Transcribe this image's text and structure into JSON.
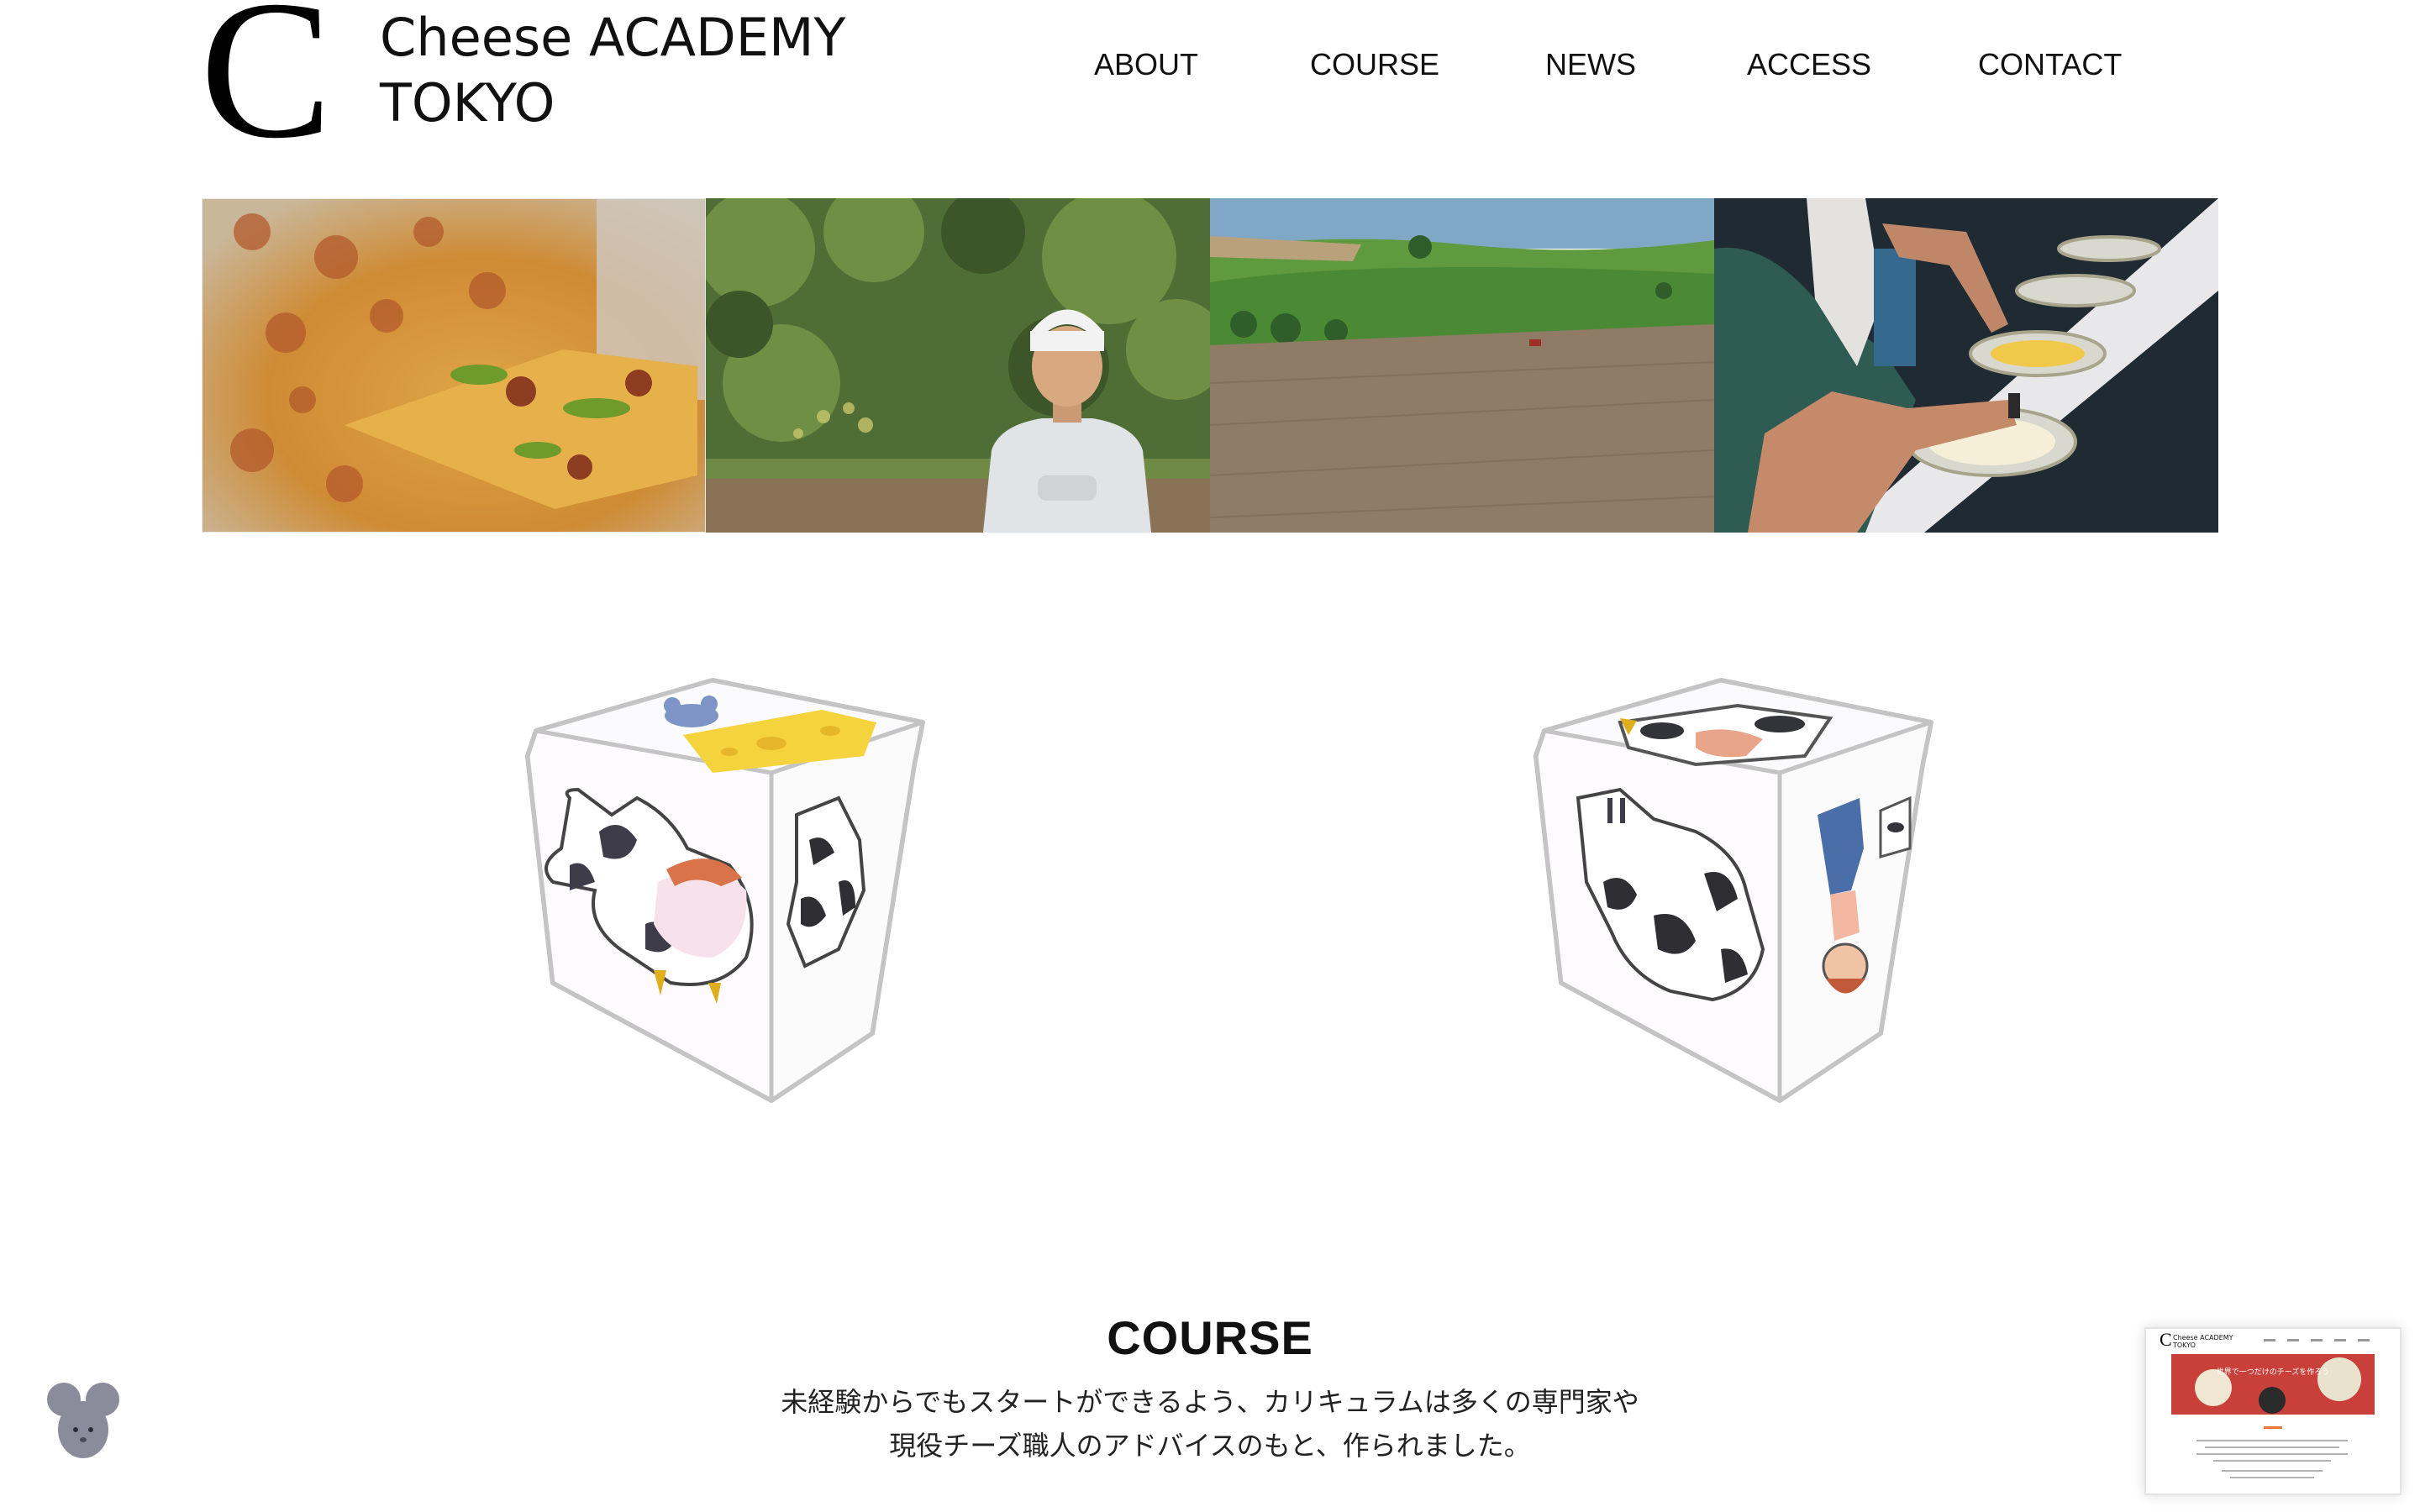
{
  "brand": {
    "logo_letter": "C",
    "name_line1": "Cheese ACADEMY",
    "name_line2": "TOKYO"
  },
  "nav": {
    "items": [
      {
        "label": "ABOUT"
      },
      {
        "label": "COURSE"
      },
      {
        "label": "NEWS"
      },
      {
        "label": "ACCESS"
      },
      {
        "label": "CONTACT"
      }
    ]
  },
  "hero": {
    "images": [
      "pizza-photo",
      "farmer-photo",
      "farmland-photo",
      "cheese-buffet-photo"
    ]
  },
  "cubes": {
    "images": [
      "cow-cat-mouse-cheese-cube",
      "cow-farmer-cube"
    ]
  },
  "course": {
    "title": "COURSE",
    "line1": "未経験からでもスタートができるよう、カリキュラムは多くの専門家や",
    "line2": "現役チーズ職人のアドバイスのもと、作られました。"
  },
  "preview": {
    "brand_line1": "Cheese ACADEMY",
    "brand_line2": "TOKYO",
    "banner_text": "世界で一つだけのチーズを作ろう"
  },
  "colors": {
    "background": "#ffffff",
    "text": "#111111",
    "mouse": "#8a8c9c",
    "cheese": "#f5d33c",
    "preview_accent": "#e8743a"
  }
}
